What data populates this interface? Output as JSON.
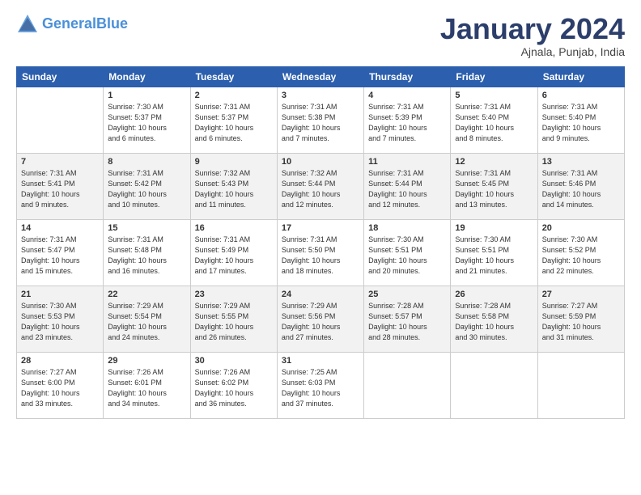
{
  "logo": {
    "line1": "General",
    "line2": "Blue"
  },
  "title": "January 2024",
  "subtitle": "Ajnala, Punjab, India",
  "weekdays": [
    "Sunday",
    "Monday",
    "Tuesday",
    "Wednesday",
    "Thursday",
    "Friday",
    "Saturday"
  ],
  "weeks": [
    [
      {
        "day": "",
        "text": ""
      },
      {
        "day": "1",
        "text": "Sunrise: 7:30 AM\nSunset: 5:37 PM\nDaylight: 10 hours\nand 6 minutes."
      },
      {
        "day": "2",
        "text": "Sunrise: 7:31 AM\nSunset: 5:37 PM\nDaylight: 10 hours\nand 6 minutes."
      },
      {
        "day": "3",
        "text": "Sunrise: 7:31 AM\nSunset: 5:38 PM\nDaylight: 10 hours\nand 7 minutes."
      },
      {
        "day": "4",
        "text": "Sunrise: 7:31 AM\nSunset: 5:39 PM\nDaylight: 10 hours\nand 7 minutes."
      },
      {
        "day": "5",
        "text": "Sunrise: 7:31 AM\nSunset: 5:40 PM\nDaylight: 10 hours\nand 8 minutes."
      },
      {
        "day": "6",
        "text": "Sunrise: 7:31 AM\nSunset: 5:40 PM\nDaylight: 10 hours\nand 9 minutes."
      }
    ],
    [
      {
        "day": "7",
        "text": "Sunrise: 7:31 AM\nSunset: 5:41 PM\nDaylight: 10 hours\nand 9 minutes."
      },
      {
        "day": "8",
        "text": "Sunrise: 7:31 AM\nSunset: 5:42 PM\nDaylight: 10 hours\nand 10 minutes."
      },
      {
        "day": "9",
        "text": "Sunrise: 7:32 AM\nSunset: 5:43 PM\nDaylight: 10 hours\nand 11 minutes."
      },
      {
        "day": "10",
        "text": "Sunrise: 7:32 AM\nSunset: 5:44 PM\nDaylight: 10 hours\nand 12 minutes."
      },
      {
        "day": "11",
        "text": "Sunrise: 7:31 AM\nSunset: 5:44 PM\nDaylight: 10 hours\nand 12 minutes."
      },
      {
        "day": "12",
        "text": "Sunrise: 7:31 AM\nSunset: 5:45 PM\nDaylight: 10 hours\nand 13 minutes."
      },
      {
        "day": "13",
        "text": "Sunrise: 7:31 AM\nSunset: 5:46 PM\nDaylight: 10 hours\nand 14 minutes."
      }
    ],
    [
      {
        "day": "14",
        "text": "Sunrise: 7:31 AM\nSunset: 5:47 PM\nDaylight: 10 hours\nand 15 minutes."
      },
      {
        "day": "15",
        "text": "Sunrise: 7:31 AM\nSunset: 5:48 PM\nDaylight: 10 hours\nand 16 minutes."
      },
      {
        "day": "16",
        "text": "Sunrise: 7:31 AM\nSunset: 5:49 PM\nDaylight: 10 hours\nand 17 minutes."
      },
      {
        "day": "17",
        "text": "Sunrise: 7:31 AM\nSunset: 5:50 PM\nDaylight: 10 hours\nand 18 minutes."
      },
      {
        "day": "18",
        "text": "Sunrise: 7:30 AM\nSunset: 5:51 PM\nDaylight: 10 hours\nand 20 minutes."
      },
      {
        "day": "19",
        "text": "Sunrise: 7:30 AM\nSunset: 5:51 PM\nDaylight: 10 hours\nand 21 minutes."
      },
      {
        "day": "20",
        "text": "Sunrise: 7:30 AM\nSunset: 5:52 PM\nDaylight: 10 hours\nand 22 minutes."
      }
    ],
    [
      {
        "day": "21",
        "text": "Sunrise: 7:30 AM\nSunset: 5:53 PM\nDaylight: 10 hours\nand 23 minutes."
      },
      {
        "day": "22",
        "text": "Sunrise: 7:29 AM\nSunset: 5:54 PM\nDaylight: 10 hours\nand 24 minutes."
      },
      {
        "day": "23",
        "text": "Sunrise: 7:29 AM\nSunset: 5:55 PM\nDaylight: 10 hours\nand 26 minutes."
      },
      {
        "day": "24",
        "text": "Sunrise: 7:29 AM\nSunset: 5:56 PM\nDaylight: 10 hours\nand 27 minutes."
      },
      {
        "day": "25",
        "text": "Sunrise: 7:28 AM\nSunset: 5:57 PM\nDaylight: 10 hours\nand 28 minutes."
      },
      {
        "day": "26",
        "text": "Sunrise: 7:28 AM\nSunset: 5:58 PM\nDaylight: 10 hours\nand 30 minutes."
      },
      {
        "day": "27",
        "text": "Sunrise: 7:27 AM\nSunset: 5:59 PM\nDaylight: 10 hours\nand 31 minutes."
      }
    ],
    [
      {
        "day": "28",
        "text": "Sunrise: 7:27 AM\nSunset: 6:00 PM\nDaylight: 10 hours\nand 33 minutes."
      },
      {
        "day": "29",
        "text": "Sunrise: 7:26 AM\nSunset: 6:01 PM\nDaylight: 10 hours\nand 34 minutes."
      },
      {
        "day": "30",
        "text": "Sunrise: 7:26 AM\nSunset: 6:02 PM\nDaylight: 10 hours\nand 36 minutes."
      },
      {
        "day": "31",
        "text": "Sunrise: 7:25 AM\nSunset: 6:03 PM\nDaylight: 10 hours\nand 37 minutes."
      },
      {
        "day": "",
        "text": ""
      },
      {
        "day": "",
        "text": ""
      },
      {
        "day": "",
        "text": ""
      }
    ]
  ]
}
